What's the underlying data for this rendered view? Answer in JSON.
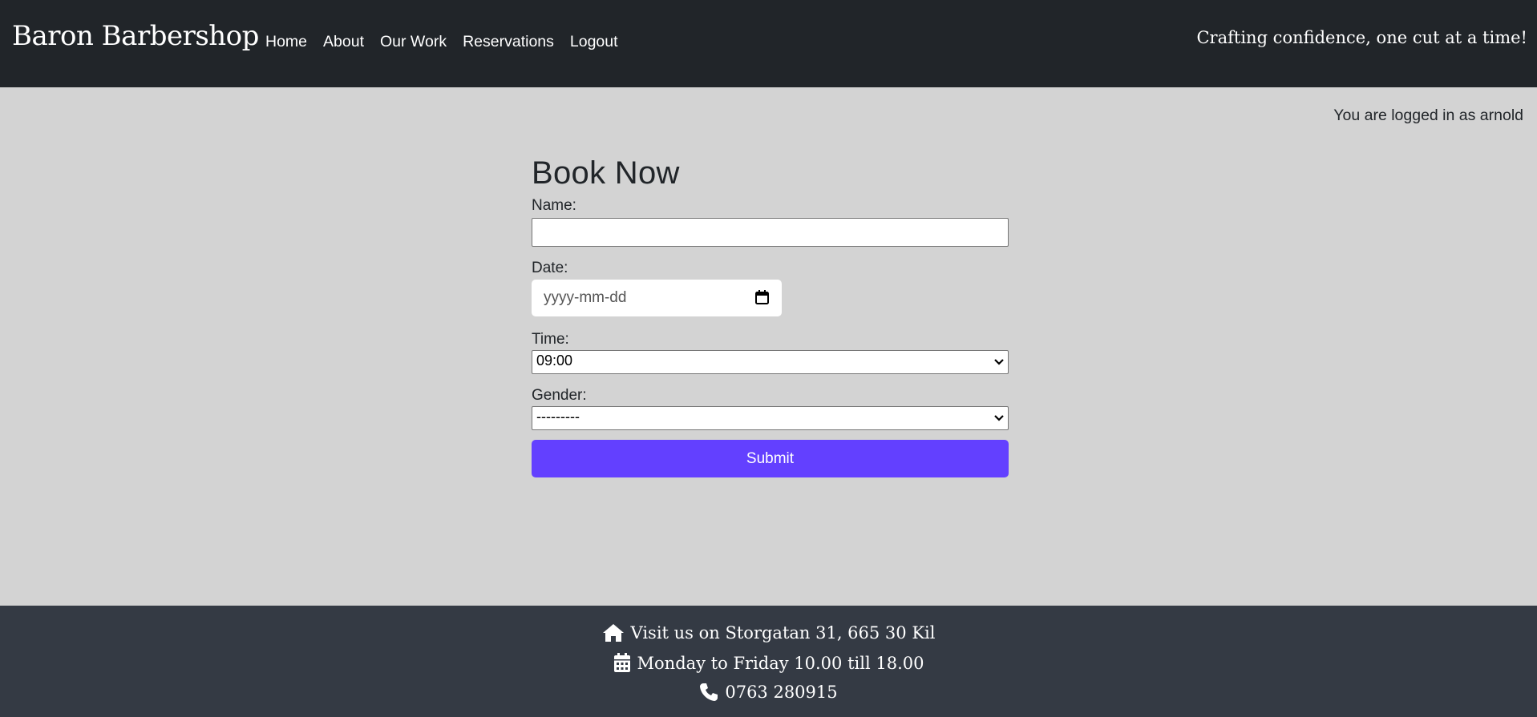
{
  "header": {
    "brand": "Baron Barbershop",
    "nav": [
      "Home",
      "About",
      "Our Work",
      "Reservations",
      "Logout"
    ],
    "tagline": "Crafting confidence, one cut at a time!"
  },
  "status": {
    "logged_in_text": "You are logged in as arnold"
  },
  "form": {
    "title": "Book Now",
    "name_label": "Name:",
    "name_value": "",
    "date_label": "Date:",
    "date_placeholder": "yyyy-mm-dd",
    "time_label": "Time:",
    "time_value": "09:00",
    "gender_label": "Gender:",
    "gender_value": "---------",
    "submit_label": "Submit"
  },
  "footer": {
    "address": "Visit us on Storgatan 31, 665 30 Kil",
    "hours": "Monday to Friday 10.00 till 18.00",
    "phone": "0763 280915"
  },
  "colors": {
    "header_bg": "#212529",
    "page_bg": "#d3d3d3",
    "footer_bg": "#343a44",
    "accent": "#6340ff"
  },
  "icons": [
    "home-icon",
    "calendar-icon",
    "phone-icon",
    "calendar-picker-icon",
    "chevron-down-icon"
  ]
}
